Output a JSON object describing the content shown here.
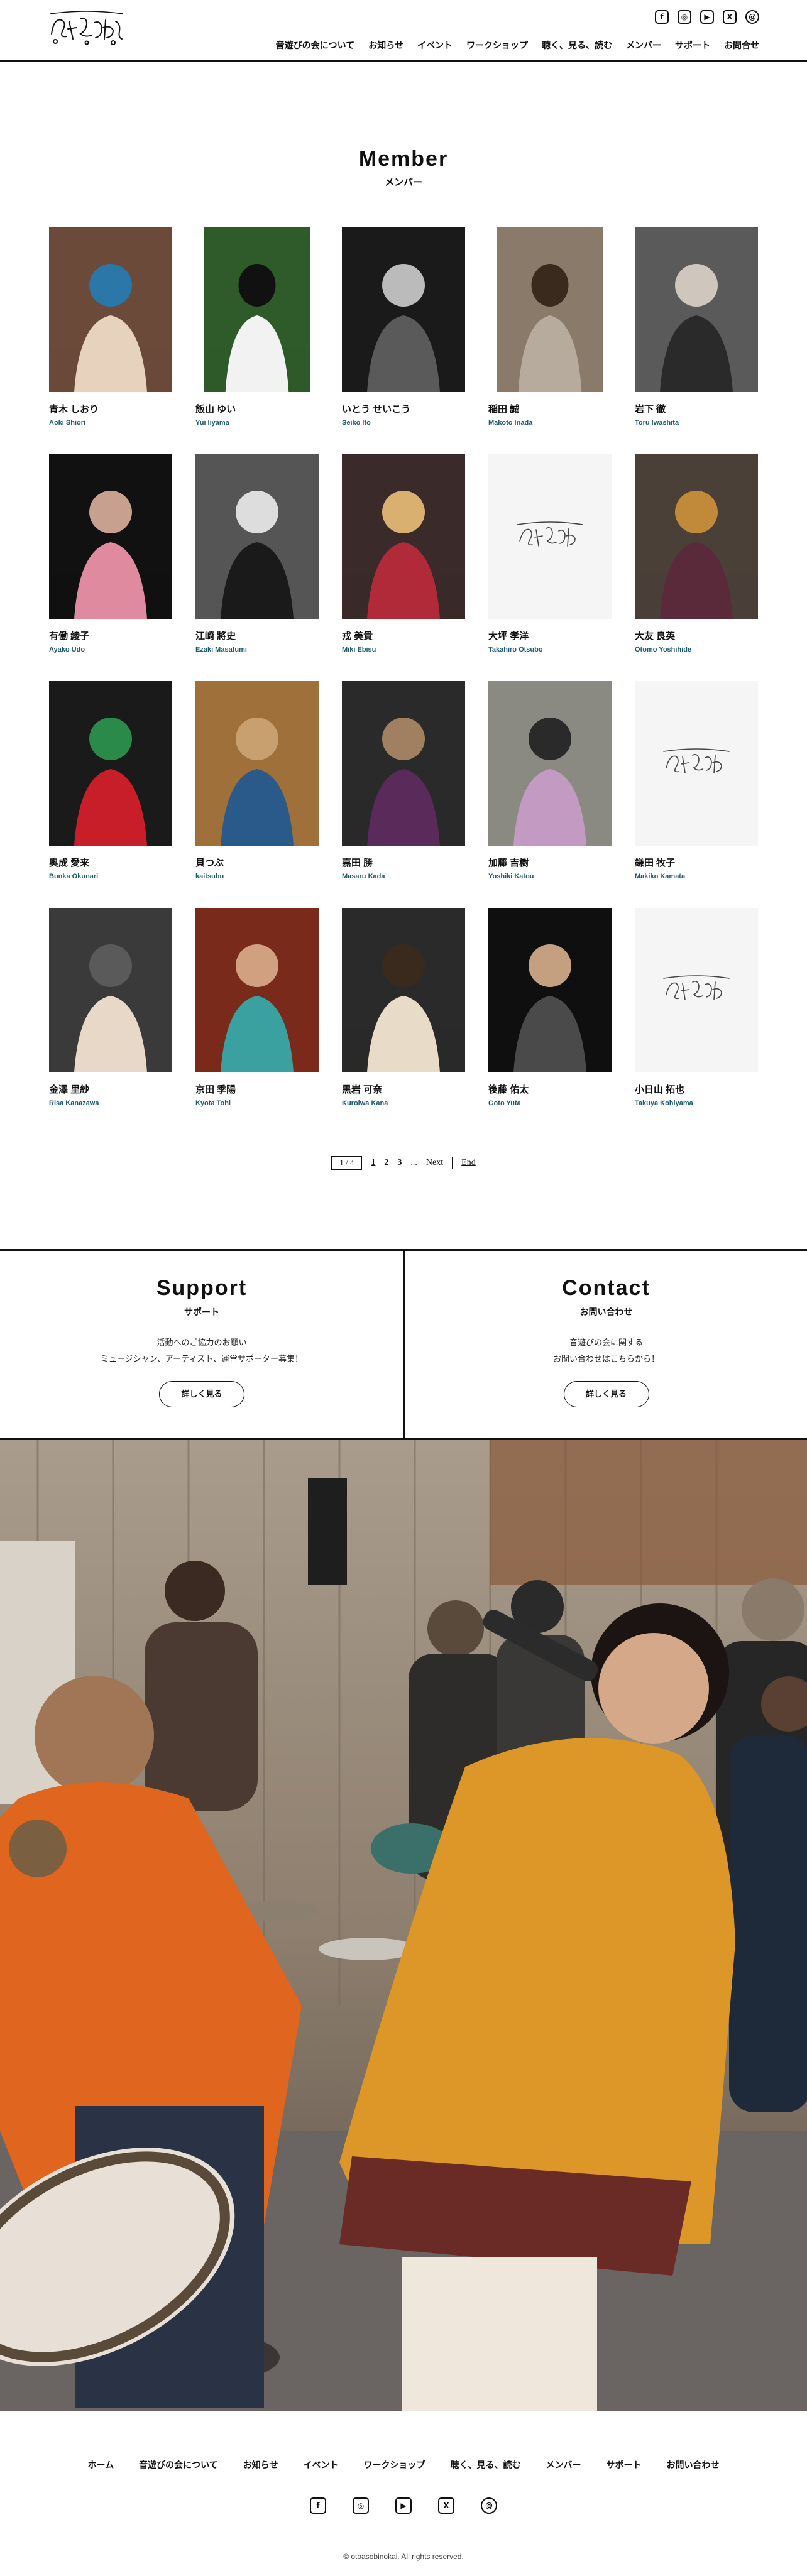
{
  "header": {
    "logo_alt": "音遊びの会",
    "social": [
      {
        "icon": "facebook-icon",
        "glyph": "f"
      },
      {
        "icon": "instagram-icon",
        "glyph": "◎"
      },
      {
        "icon": "youtube-icon",
        "glyph": "▶"
      },
      {
        "icon": "x-icon",
        "glyph": "X"
      },
      {
        "icon": "threads-icon",
        "glyph": "@"
      }
    ],
    "nav": [
      "音遊びの会について",
      "お知らせ",
      "イベント",
      "ワークショップ",
      "聴く、見る、読む",
      "メンバー",
      "サポート",
      "お問合せ"
    ]
  },
  "title": {
    "en": "Member",
    "ja": "メンバー"
  },
  "members": [
    {
      "name": "青木 しおり",
      "roman": "Aoki Shiori"
    },
    {
      "name": "飯山 ゆい",
      "roman": "Yui Iiyama"
    },
    {
      "name": "いとう せいこう",
      "roman": "Seiko Ito"
    },
    {
      "name": "稲田 誠",
      "roman": "Makoto Inada"
    },
    {
      "name": "岩下 徹",
      "roman": "Toru Iwashita"
    },
    {
      "name": "有働 綾子",
      "roman": "Ayako Udo"
    },
    {
      "name": "江崎 將史",
      "roman": "Ezaki Masafumi"
    },
    {
      "name": "戎 美貴",
      "roman": "Miki Ebisu"
    },
    {
      "name": "大坪 孝洋",
      "roman": "Takahiro Otsubo"
    },
    {
      "name": "大友 良英",
      "roman": "Otomo Yoshihide"
    },
    {
      "name": "奥成 愛来",
      "roman": "Bunka Okunari"
    },
    {
      "name": "貝つぶ",
      "roman": "kaitsubu"
    },
    {
      "name": "嘉田 勝",
      "roman": "Masaru Kada"
    },
    {
      "name": "加藤 吉樹",
      "roman": "Yoshiki Katou"
    },
    {
      "name": "鎌田 牧子",
      "roman": "Makiko Kamata"
    },
    {
      "name": "金澤 里紗",
      "roman": "Risa Kanazawa"
    },
    {
      "name": "京田 季陽",
      "roman": "Kyota Tohi"
    },
    {
      "name": "黒岩 可奈",
      "roman": "Kuroiwa Kana"
    },
    {
      "name": "後藤 佑太",
      "roman": "Goto Yuta"
    },
    {
      "name": "小日山 拓也",
      "roman": "Takuya Kohiyama"
    }
  ],
  "pagination": {
    "box": "1 / 4",
    "pages": [
      "1",
      "2",
      "3"
    ],
    "ellipsis": "...",
    "next": "Next",
    "end": "End"
  },
  "support": {
    "en": "Support",
    "ja": "サポート",
    "desc1": "活動へのご協力のお願い",
    "desc2": "ミュージシャン、アーティスト、運営サポーター募集！",
    "button": "詳しく見る"
  },
  "contact": {
    "en": "Contact",
    "ja": "お問い合わせ",
    "desc1": "音遊びの会に関する",
    "desc2": "お問い合わせはこちらから！",
    "button": "詳しく見る"
  },
  "footer": {
    "nav": [
      "ホーム",
      "音遊びの会について",
      "お知らせ",
      "イベント",
      "ワークショップ",
      "聴く、見る、読む",
      "メンバー",
      "サポート",
      "お問い合わせ"
    ],
    "copyright": "© otoasobinokai. All rights reserved."
  },
  "colors": {
    "accent": "#1b5a70",
    "text": "#111111",
    "placeholder_bg": "#f5f5f5"
  }
}
